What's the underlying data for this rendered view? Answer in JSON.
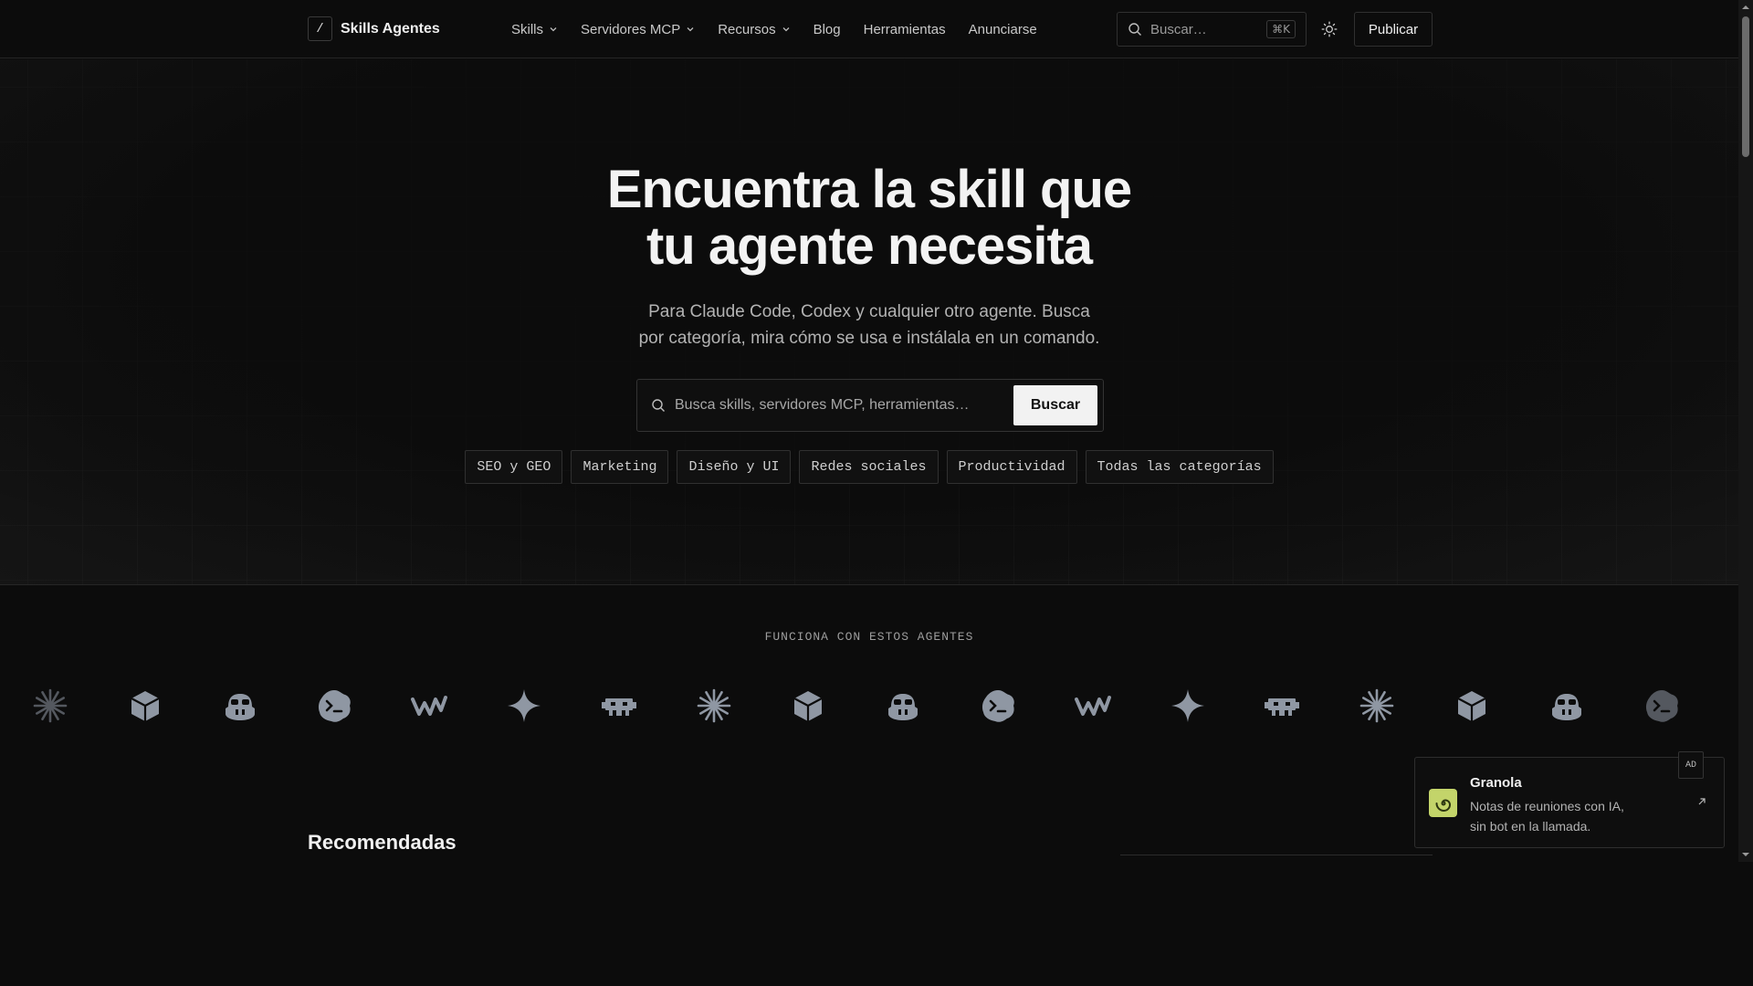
{
  "header": {
    "brand_mark": "/",
    "brand_name": "Skills Agentes",
    "nav": [
      {
        "label": "Skills",
        "has_dropdown": true
      },
      {
        "label": "Servidores MCP",
        "has_dropdown": true
      },
      {
        "label": "Recursos",
        "has_dropdown": true
      },
      {
        "label": "Blog",
        "has_dropdown": false
      },
      {
        "label": "Herramientas",
        "has_dropdown": false
      },
      {
        "label": "Anunciarse",
        "has_dropdown": false
      }
    ],
    "search_placeholder": "Buscar…",
    "search_shortcut": "⌘K",
    "theme_icon": "sun-icon",
    "publish_label": "Publicar"
  },
  "hero": {
    "title_line1": "Encuentra la skill que",
    "title_line2": "tu agente necesita",
    "subtitle_line1": "Para Claude Code, Codex y cualquier otro agente. Busca",
    "subtitle_line2": "por categoría, mira cómo se usa e instálala en un comando.",
    "search_placeholder": "Busca skills, servidores MCP, herramientas…",
    "search_button": "Buscar",
    "chips": [
      "SEO y GEO",
      "Marketing",
      "Diseño y UI",
      "Redes sociales",
      "Productividad",
      "Todas las categorías"
    ]
  },
  "agents": {
    "label": "FUNCIONA CON ESTOS AGENTES",
    "icons": [
      "sparkle-burst-icon",
      "cube-icon",
      "copilot-icon",
      "terminal-blob-icon",
      "windsurf-icon",
      "four-point-star-icon",
      "invader-icon",
      "sparkle-burst-icon",
      "cube-icon",
      "copilot-icon",
      "terminal-blob-icon",
      "windsurf-icon",
      "four-point-star-icon",
      "invader-icon",
      "sparkle-burst-icon",
      "cube-icon",
      "copilot-icon",
      "terminal-blob-icon"
    ]
  },
  "recommended": {
    "title": "Recomendadas"
  },
  "ad": {
    "badge": "AD",
    "name": "Granola",
    "desc_line1": "Notas de reuniones con IA,",
    "desc_line2": "sin bot en la llamada.",
    "logo_color": "#c3d46a"
  },
  "colors": {
    "background": "#0c0c0c",
    "accent_button": "#f2f2f2",
    "icon_gray": "#8f97a3"
  }
}
